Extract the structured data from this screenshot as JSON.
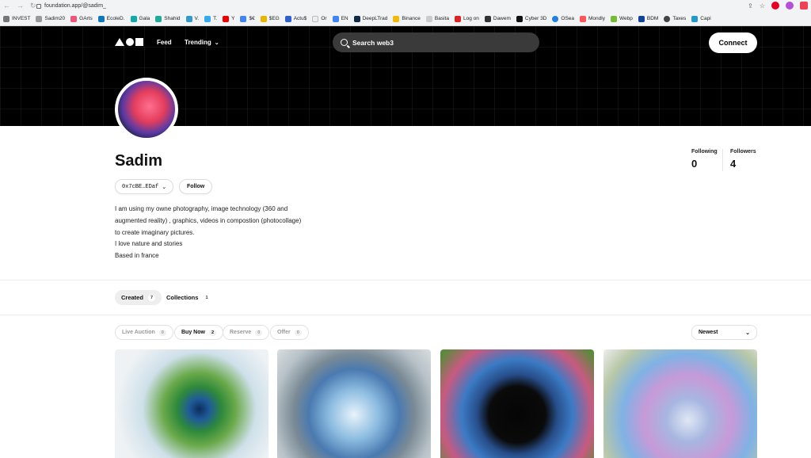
{
  "browser": {
    "url": "foundation.app/@sadim_",
    "bookmarks": [
      "INVEST",
      "Sadim20",
      "GArts",
      "EcoleD.",
      "Gala",
      "Shahid",
      "V.",
      "T.",
      "Y",
      "$€",
      "$EG",
      "Actu$",
      "Or",
      "EN",
      "DeepLTrad",
      "Binance",
      "Basita",
      "Log on",
      "Dawem",
      "Cyber 3D",
      "OSea",
      "Mondly",
      "Webp",
      "BDM",
      "Taxes",
      "Capi"
    ],
    "icons": [
      "back-icon",
      "forward-icon",
      "reload-icon",
      "share-icon",
      "star-icon",
      "pinterest-icon",
      "extension-icon",
      "pocket-icon"
    ]
  },
  "header": {
    "feed": "Feed",
    "trending": "Trending",
    "search_placeholder": "Search web3",
    "connect": "Connect"
  },
  "profile": {
    "name": "Sadim",
    "address": "0x7cBE…EDaf",
    "follow": "Follow",
    "bio": [
      "I am using my owne photography, image technology (360 and",
      "augmented reality) , graphics, videos in compostion (photocollage)",
      "to create imaginary pictures.",
      "I love nature and stories",
      "Based in france"
    ],
    "following_label": "Following",
    "following_count": "0",
    "followers_label": "Followers",
    "followers_count": "4"
  },
  "tabs": [
    {
      "label": "Created",
      "count": "7"
    },
    {
      "label": "Collections",
      "count": "1"
    }
  ],
  "filters": [
    {
      "label": "Live Auction",
      "count": "0"
    },
    {
      "label": "Buy Now",
      "count": "2"
    },
    {
      "label": "Reserve",
      "count": "0"
    },
    {
      "label": "Offer",
      "count": "0"
    }
  ],
  "sort": {
    "value": "Newest"
  },
  "colors": {
    "hero_bg": "#000000",
    "accent": "#ffffff"
  }
}
